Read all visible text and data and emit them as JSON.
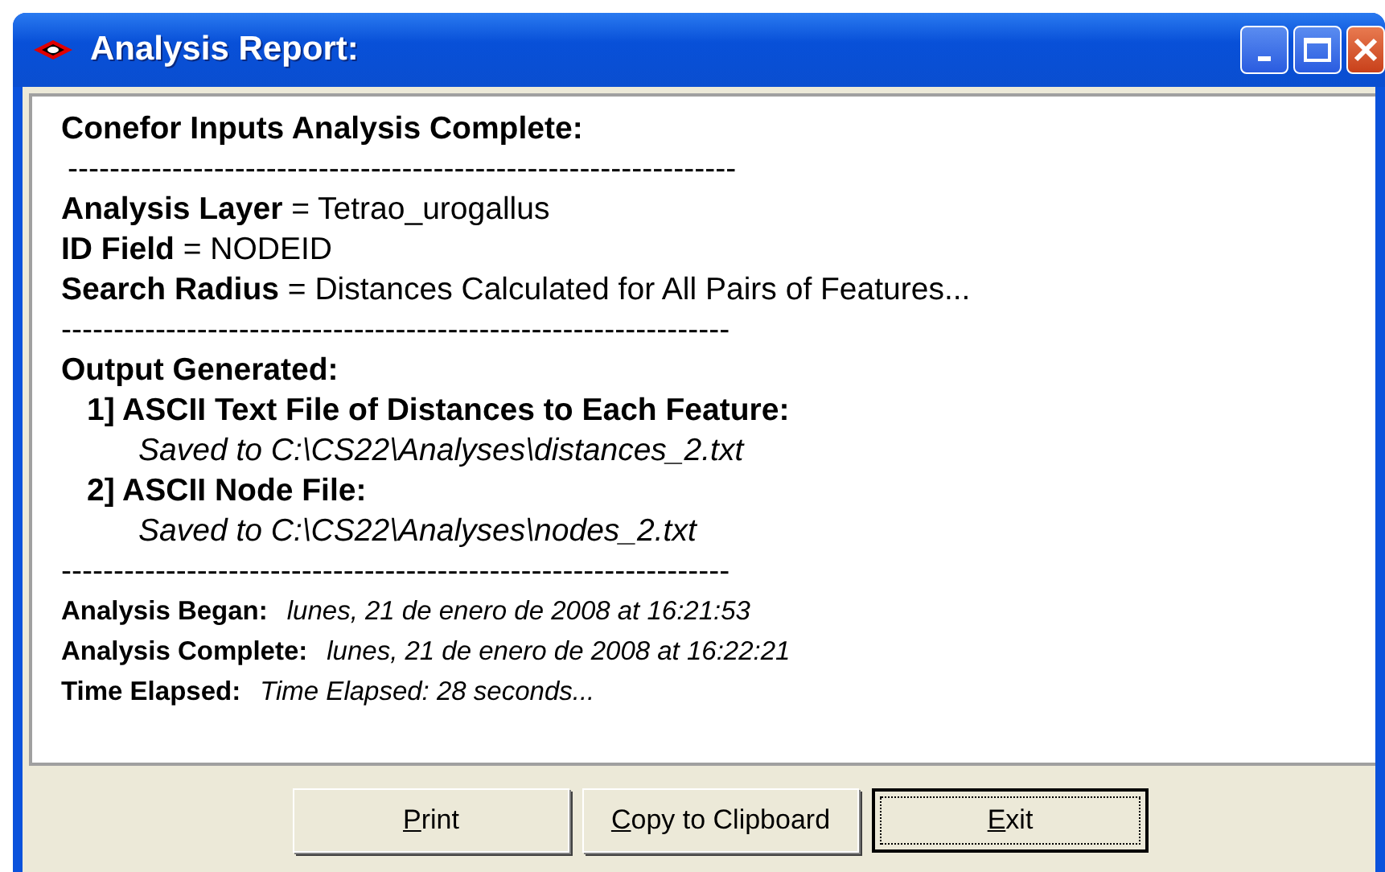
{
  "window": {
    "title": "Analysis Report:"
  },
  "report": [
    {
      "kind": "heading",
      "text": "Conefor Inputs Analysis Complete:"
    },
    {
      "kind": "separator",
      "text": "----------------------------------------------------------------"
    },
    {
      "kind": "field",
      "label": "Analysis Layer",
      "sep": " = ",
      "value": "Tetrao_urogallus"
    },
    {
      "kind": "field",
      "label": "ID Field",
      "sep": " = ",
      "value": "NODEID"
    },
    {
      "kind": "field",
      "label": "Search Radius",
      "sep": " = ",
      "value": "Distances Calculated for All Pairs of Features..."
    },
    {
      "kind": "separator",
      "text": "----------------------------------------------------------------"
    },
    {
      "kind": "heading",
      "text": "Output Generated:"
    },
    {
      "kind": "item",
      "text": "1] ASCII Text File of Distances to Each Feature:"
    },
    {
      "kind": "path",
      "text": "Saved to C:\\CS22\\Analyses\\distances_2.txt"
    },
    {
      "kind": "item",
      "text": "2] ASCII Node File:"
    },
    {
      "kind": "path",
      "text": "Saved to C:\\CS22\\Analyses\\nodes_2.txt"
    },
    {
      "kind": "separator",
      "text": "----------------------------------------------------------------"
    },
    {
      "kind": "time",
      "label": "Analysis Began:",
      "value": "lunes, 21 de enero de 2008 at 16:21:53"
    },
    {
      "kind": "time",
      "label": "Analysis Complete:",
      "value": "lunes, 21 de enero de 2008 at 16:22:21"
    },
    {
      "kind": "time",
      "label": "Time Elapsed:",
      "value": "Time Elapsed: 28 seconds..."
    }
  ],
  "buttons": [
    {
      "label": "Print",
      "focused": false
    },
    {
      "label": "Copy to Clipboard",
      "focused": false
    },
    {
      "label": "Exit",
      "focused": true
    }
  ]
}
